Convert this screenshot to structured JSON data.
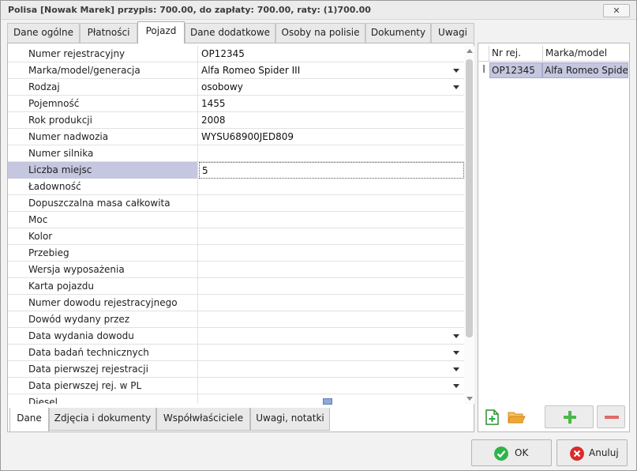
{
  "window": {
    "title": "Polisa [Nowak Marek] przypis: 700.00, do zapłaty: 700.00, raty: (1)700.00",
    "close_label": "✕"
  },
  "tabs": [
    {
      "label": "Dane ogólne"
    },
    {
      "label": "Płatności"
    },
    {
      "label": "Pojazd",
      "active": true
    },
    {
      "label": "Dane dodatkowe"
    },
    {
      "label": "Osoby na polisie"
    },
    {
      "label": "Dokumenty"
    },
    {
      "label": "Uwagi"
    }
  ],
  "vehicle_fields": [
    {
      "label": "Numer rejestracyjny",
      "value": "OP12345",
      "dropdown": false
    },
    {
      "label": "Marka/model/generacja",
      "value": "Alfa Romeo Spider III",
      "dropdown": true
    },
    {
      "label": "Rodzaj",
      "value": "osobowy",
      "dropdown": true
    },
    {
      "label": "Pojemność",
      "value": "1455",
      "dropdown": false
    },
    {
      "label": "Rok produkcji",
      "value": "2008",
      "dropdown": false
    },
    {
      "label": "Numer nadwozia",
      "value": "WYSU68900JED809",
      "dropdown": false
    },
    {
      "label": "Numer silnika",
      "value": "",
      "dropdown": false
    },
    {
      "label": "Liczba miejsc",
      "value": "5",
      "dropdown": false,
      "selected": true
    },
    {
      "label": "Ładowność",
      "value": "",
      "dropdown": false
    },
    {
      "label": "Dopuszczalna masa całkowita",
      "value": "",
      "dropdown": false
    },
    {
      "label": "Moc",
      "value": "",
      "dropdown": false
    },
    {
      "label": "Kolor",
      "value": "",
      "dropdown": false
    },
    {
      "label": "Przebieg",
      "value": "",
      "dropdown": false
    },
    {
      "label": "Wersja wyposażenia",
      "value": "",
      "dropdown": false
    },
    {
      "label": "Karta pojazdu",
      "value": "",
      "dropdown": false
    },
    {
      "label": "Numer dowodu rejestracyjnego",
      "value": "",
      "dropdown": false
    },
    {
      "label": "Dowód wydany przez",
      "value": "",
      "dropdown": false
    },
    {
      "label": "Data wydania dowodu",
      "value": "",
      "dropdown": true
    },
    {
      "label": "Data badań technicznych",
      "value": "",
      "dropdown": true
    },
    {
      "label": "Data pierwszej rejestracji",
      "value": "",
      "dropdown": true
    },
    {
      "label": "Data pierwszej rej. w PL",
      "value": "",
      "dropdown": true
    },
    {
      "label": "Diesel",
      "value": "",
      "dropdown": false
    }
  ],
  "bottom_tabs": [
    {
      "label": "Dane",
      "active": true
    },
    {
      "label": "Zdjęcia i dokumenty"
    },
    {
      "label": "Współwłaściciele"
    },
    {
      "label": "Uwagi, notatki"
    }
  ],
  "vehicle_list": {
    "columns": [
      "Nr rej.",
      "Marka/model"
    ],
    "rows": [
      {
        "indicator": "I",
        "nr_rej": "OP12345",
        "marka": "Alfa Romeo Spider III"
      }
    ]
  },
  "buttons": {
    "ok": "OK",
    "cancel": "Anuluj"
  },
  "colors": {
    "selection": "#c5c6df",
    "ok_icon": "#2fb44a",
    "cancel_icon": "#d92b2b",
    "add_icon": "#49b84a",
    "remove_icon": "#e06a6a",
    "folder_icon": "#f0a732"
  },
  "icons": [
    "new-document-icon",
    "open-folder-icon",
    "add-icon",
    "remove-icon",
    "check-icon",
    "cancel-icon"
  ]
}
